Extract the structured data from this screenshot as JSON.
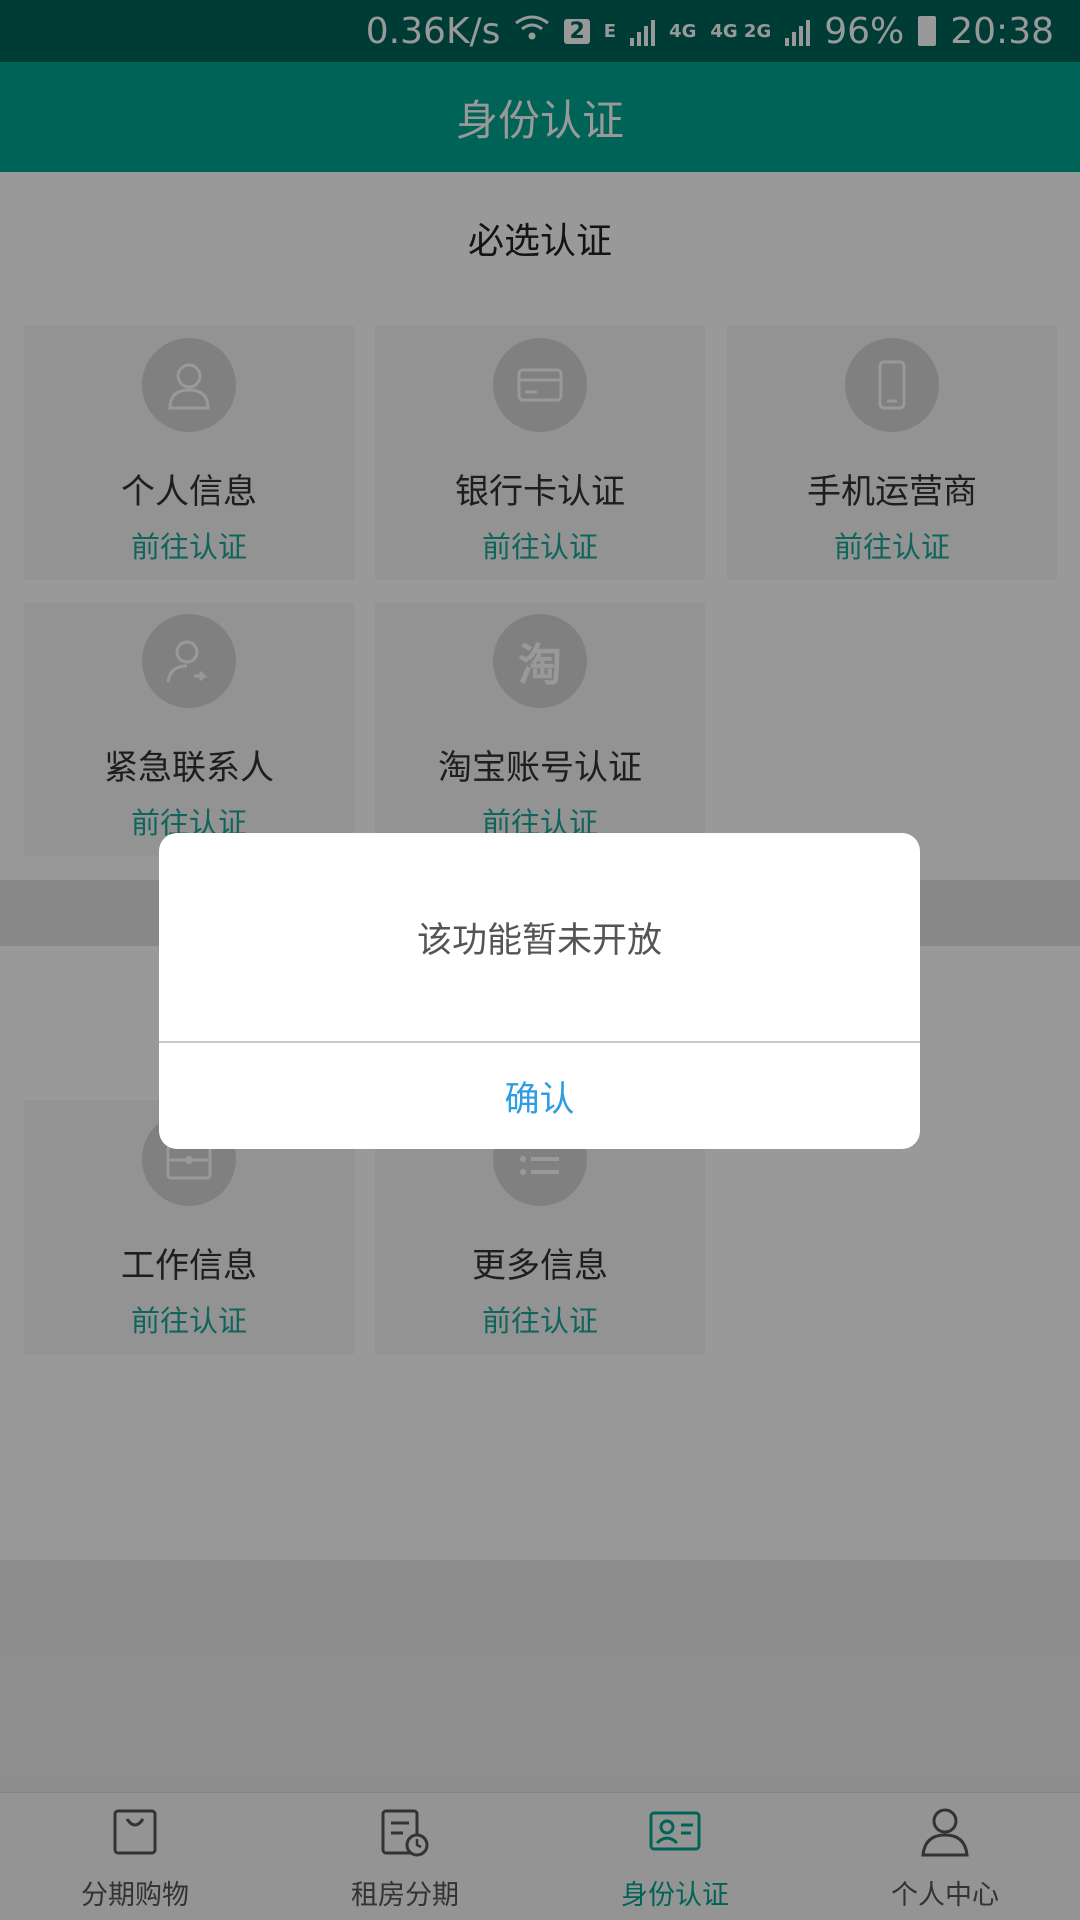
{
  "status_bar": {
    "net_speed": "0.36K/s",
    "sim_badge": "2",
    "net_e": "E",
    "net_4g": "4G",
    "net_4g2g": "4G 2G",
    "battery": "96%",
    "time": "20:38"
  },
  "header": {
    "title": "身份认证"
  },
  "required_section": {
    "title": "必选认证",
    "items": [
      {
        "label": "个人信息",
        "action": "前往认证",
        "icon": "person-icon"
      },
      {
        "label": "银行卡认证",
        "action": "前往认证",
        "icon": "bank-card-icon"
      },
      {
        "label": "手机运营商",
        "action": "前往认证",
        "icon": "phone-icon"
      },
      {
        "label": "紧急联系人",
        "action": "前往认证",
        "icon": "contact-icon"
      },
      {
        "label": "淘宝账号认证",
        "action": "前往认证",
        "icon": "taobao-icon",
        "glyph": "淘"
      }
    ]
  },
  "optional_section": {
    "items": [
      {
        "label": "工作信息",
        "action": "前往认证",
        "icon": "briefcase-icon"
      },
      {
        "label": "更多信息",
        "action": "前往认证",
        "icon": "list-icon"
      }
    ]
  },
  "dialog": {
    "message": "该功能暂未开放",
    "confirm": "确认"
  },
  "tabbar": {
    "tabs": [
      {
        "label": "分期购物",
        "icon": "shopping-bag-icon"
      },
      {
        "label": "租房分期",
        "icon": "calendar-clock-icon"
      },
      {
        "label": "身份认证",
        "icon": "id-card-icon",
        "active": true
      },
      {
        "label": "个人中心",
        "icon": "user-icon"
      }
    ]
  },
  "colors": {
    "primary": "#00a693",
    "status_bar": "#00655a",
    "link": "#1aa89a",
    "dialog_button": "#2f9de4"
  }
}
